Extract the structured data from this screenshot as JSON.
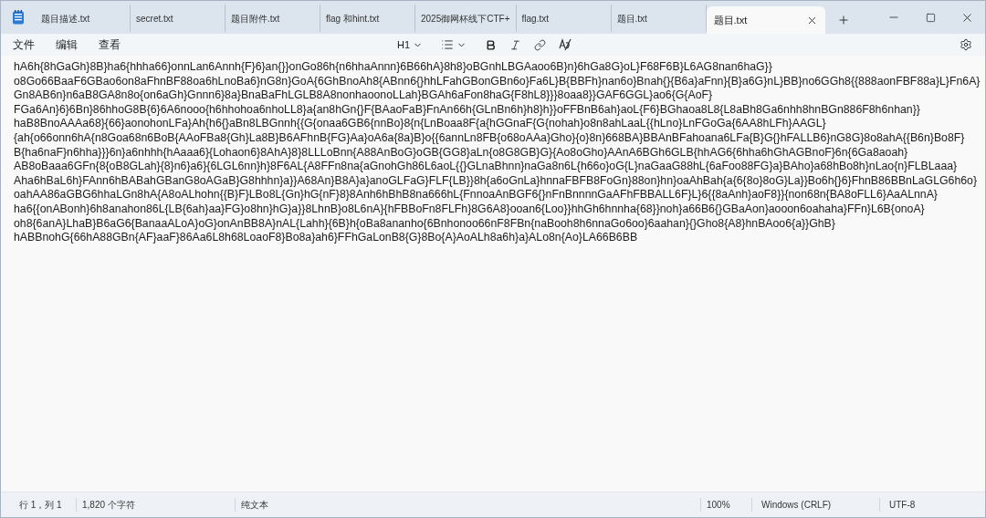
{
  "tabs": [
    {
      "label": "题目描述.txt",
      "selected": false
    },
    {
      "label": "secret.txt",
      "selected": false
    },
    {
      "label": "题目附件.txt",
      "selected": false
    },
    {
      "label": "flag 和hint.txt",
      "selected": false
    },
    {
      "label": "2025御网杯线下CTF+",
      "selected": false
    },
    {
      "label": "flag.txt",
      "selected": false
    },
    {
      "label": "题目.txt",
      "selected": false
    },
    {
      "label": "题目.txt",
      "selected": true
    }
  ],
  "menu": [
    "文件",
    "编辑",
    "查看"
  ],
  "toolbar": {
    "heading": "H1"
  },
  "document": {
    "lines": [
      "hA6h{8hGaGh}8B}ha6{hhha66}onnLan6Annh{F}6}an{}}onGo86h{n6hhaAnnn}6B66hA}8h8}oBGnhLBGAaoo6B}n}6hGa8G}oL}F68F6B}L6AG8nan6haG}}",
      "o8Go66BaaF6GBao6on8aFhnBF88oa6hLnoBa6}nG8n}GoA{6GhBnoAh8{ABnn6{}hhLFahGBonGBn6o}Fa6L}B{BBFh}nan6o}Bnah{}{B6a}aFnn}{B}a6G}nL}BB}no6GGh8{{888aonFBF88a}L}Fn6A}",
      "Gn8AB6n}n6aB8GA8n8o{on6aGh}Gnnn6}8a}BnaBaFhLGLB8A8nonhaoonoLLah}BGAh6aFon8haG{F8hL8}}}8oaa8}}GAF6GGL}ao6{G{AoF}",
      "FGa6An}6}6Bn}86hhoG8B{6}6A6nooo{h6hhohoa6nhoLL8}a{an8hGn{}F{BAaoFaB}FnAn66h{GLnBn6h}h8}h}}oFFBnB6ah}aoL{F6}BGhaoa8L8{L8aBh8Ga6nhh8hnBGn886F8h6nhan}}",
      "haB8BnoAAAa68}{66}aonohonLFa}Ah{h6{}aBn8LBGnnh{{G{onaa6GB6{nnBo}8{n{LnBoaa8F{a{hGGnaF{G{nohah}o8n8ahLaaL{{hLno}LnFGoGa{6AA8hLFh}AAGL}",
      "{ah{o66onn6hA{n8Goa68n6BoB{AAoFBa8{Gh}La8B}B6AFhnB{FG}Aa}oA6a{8a}B}o{{6annLn8FB{o68oAAa}Gho}{o}8n}668BA}BBAnBFahoana6LFa{B}G{}hFALLB6}nG8G}8o8ahA{{B6n}Bo8F}",
      "B{ha6naF}n6hha}}}6n}a6nhhh{hAaaa6}{Lohaon6}8AhA}8}8LLLoBnn{A88AnBoG}oGB{GG8}aLn{o8G8GB}G}{Ao8oGho}AAnA6BGh6GLB{hhAG6{6hha6hGhAGBnoF}6n{6Ga8aoah}",
      "AB8oBaaa6GFn{8{oB8GLah}{8}n6}a6}{6LGL6nn}h}8F6AL{A8FFn8na{aGnohGh86L6aoL{{}GLnaBhnn}naGa8n6L{h66o}oG{L}naGaaG88hL{6aFoo88FG}a}BAho}a68hBo8h}nLao{n}FLBLaaa}",
      "Aha6hBaL6h}FAnn6hBABahGBanG8oAGaB}G8hhhn}a}}A68An}B8A}a}anoGLFaG}FLF{LB}}8h{a6oGnLa}hnnaFBFB8FoGn}88on}hn}oaAhBah{a{6{8o}8oG}La}}Bo6h{}6}FhnB86BBnLaGLG6h6o}",
      "oahAA86aGBG6hhaLGn8hA{A8oALhohn{{B}F}LBo8L{Gn}hG{nF}8}8Anh6hBhB8na666hL{FnnoaAnBGF6{}nFnBnnnnGaAFhFBBALL6F}L}6{{8aAnh}aoF8}}{non68n{BA8oFLL6}AaALnnA}",
      "ha6{{onABonh}6h8anahon86L{LB{6ah}aa}FG}o8hn}hG}a}}8LhnB}o8L6nA}{hFBBoFn8FLFh}8G6A8}ooan6{Loo}}hhGh6hnnha{68}}noh}a66B6{}GBaAon}aooon6oahaha}FFn}L6B{onoA}",
      "oh8{6anA}LhaB}B6aG6{BanaaALoA}oG}onAnBB8A}nAL{Lahh}{6B}h{oBa8ananho{6Bnhonoo66nF8FBn{naBooh8h6nnaGo6oo}6aahan}{}Gho8{A8}hnBAoo6{a}}GhB}",
      "hABBnohG{66hA88GBn{AF}aaF}86Aa6L8h68LoaoF8}Bo8a}ah6}FFhGaLonB8{G}8Bo{A}AoALh8a6h}a}ALo8n{Ao}LA66B6BB"
    ]
  },
  "status_bar": {
    "position": "行 1，列 1",
    "characters": "1,820 个字符",
    "format": "纯文本",
    "zoom": "100%",
    "line_ending": "Windows (CRLF)",
    "encoding": "UTF-8"
  }
}
